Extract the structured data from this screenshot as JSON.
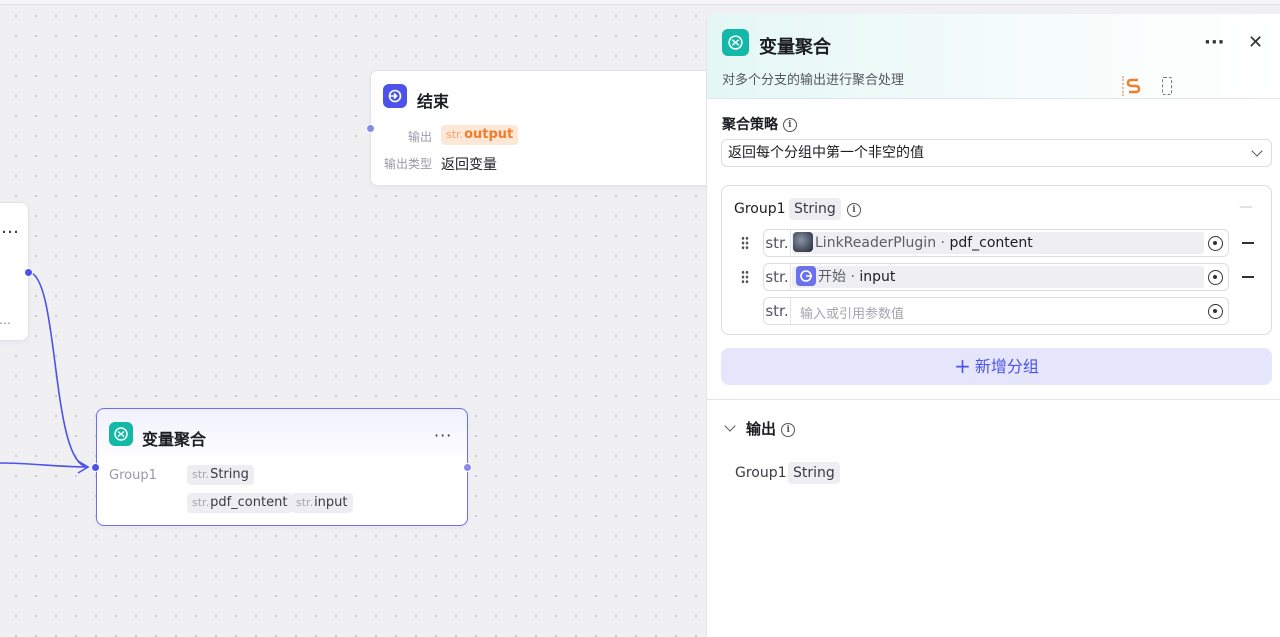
{
  "canvas": {
    "end_node": {
      "title": "结束",
      "output_label": "输出",
      "output_tag_prefix": "str.",
      "output_tag": "output",
      "output_type_label": "输出类型",
      "output_type_value": "返回变量"
    },
    "partial_node": {
      "more": "…",
      "more2": "…"
    },
    "aggregator_node": {
      "title": "变量聚合",
      "more": "···",
      "group_label": "Group1",
      "tags": [
        {
          "prefix": "str.",
          "text": "String"
        },
        {
          "prefix": "str.",
          "text": "pdf_content"
        },
        {
          "prefix": "str.",
          "text": "input"
        }
      ]
    }
  },
  "panel": {
    "title": "变量聚合",
    "description": "对多个分支的输出进行聚合处理",
    "more": "···",
    "close": "✕",
    "strategy_label": "聚合策略",
    "strategy_value": "返回每个分组中第一个非空的值",
    "group": {
      "name": "Group1",
      "type": "String",
      "collapse": "—",
      "refs": [
        {
          "prefix": "str.",
          "source": "LinkReaderPlugin",
          "sep": " · ",
          "field": "pdf_content"
        },
        {
          "prefix": "str.",
          "source": "开始",
          "sep": " · ",
          "field": "input"
        }
      ],
      "input_prefix": "str.",
      "input_placeholder": "输入或引用参数值"
    },
    "add_group_label": "新增分组",
    "add_group_plus": "+",
    "output_section": {
      "label": "输出",
      "group_name": "Group1",
      "group_type": "String"
    }
  },
  "colors": {
    "accent": "#4d53e8",
    "teal": "#14b8a6",
    "orange": "#f47c2a"
  }
}
